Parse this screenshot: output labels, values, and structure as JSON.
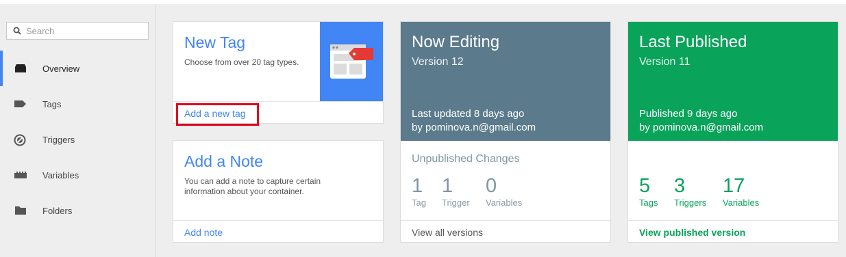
{
  "sidebar": {
    "search_placeholder": "Search",
    "items": [
      {
        "label": "Overview",
        "icon": "overview-icon",
        "active": true
      },
      {
        "label": "Tags",
        "icon": "tag-icon"
      },
      {
        "label": "Triggers",
        "icon": "trigger-icon"
      },
      {
        "label": "Variables",
        "icon": "variables-icon"
      },
      {
        "label": "Folders",
        "icon": "folder-icon"
      }
    ]
  },
  "new_tag": {
    "title": "New Tag",
    "description": "Choose from over 20 tag types.",
    "link": "Add a new tag"
  },
  "note": {
    "title": "Add a Note",
    "description": "You can add a note to capture certain information about your container.",
    "link": "Add note"
  },
  "now_editing": {
    "title": "Now Editing",
    "version": "Version 12",
    "updated": "Last updated 8 days ago",
    "by": "by pominova.n@gmail.com",
    "section_title": "Unpublished Changes",
    "stats": [
      {
        "value": "1",
        "label": "Tag"
      },
      {
        "value": "1",
        "label": "Trigger"
      },
      {
        "value": "0",
        "label": "Variables"
      }
    ],
    "link": "View all versions"
  },
  "last_published": {
    "title": "Last Published",
    "version": "Version 11",
    "published": "Published 9 days ago",
    "by": "by pominova.n@gmail.com",
    "stats": [
      {
        "value": "5",
        "label": "Tags"
      },
      {
        "value": "3",
        "label": "Triggers"
      },
      {
        "value": "17",
        "label": "Variables"
      }
    ],
    "link": "View published version"
  },
  "colors": {
    "accent": "#4285f4",
    "editing": "#5b7a8c",
    "published": "#0aa35a",
    "highlight": "#e0001b"
  }
}
